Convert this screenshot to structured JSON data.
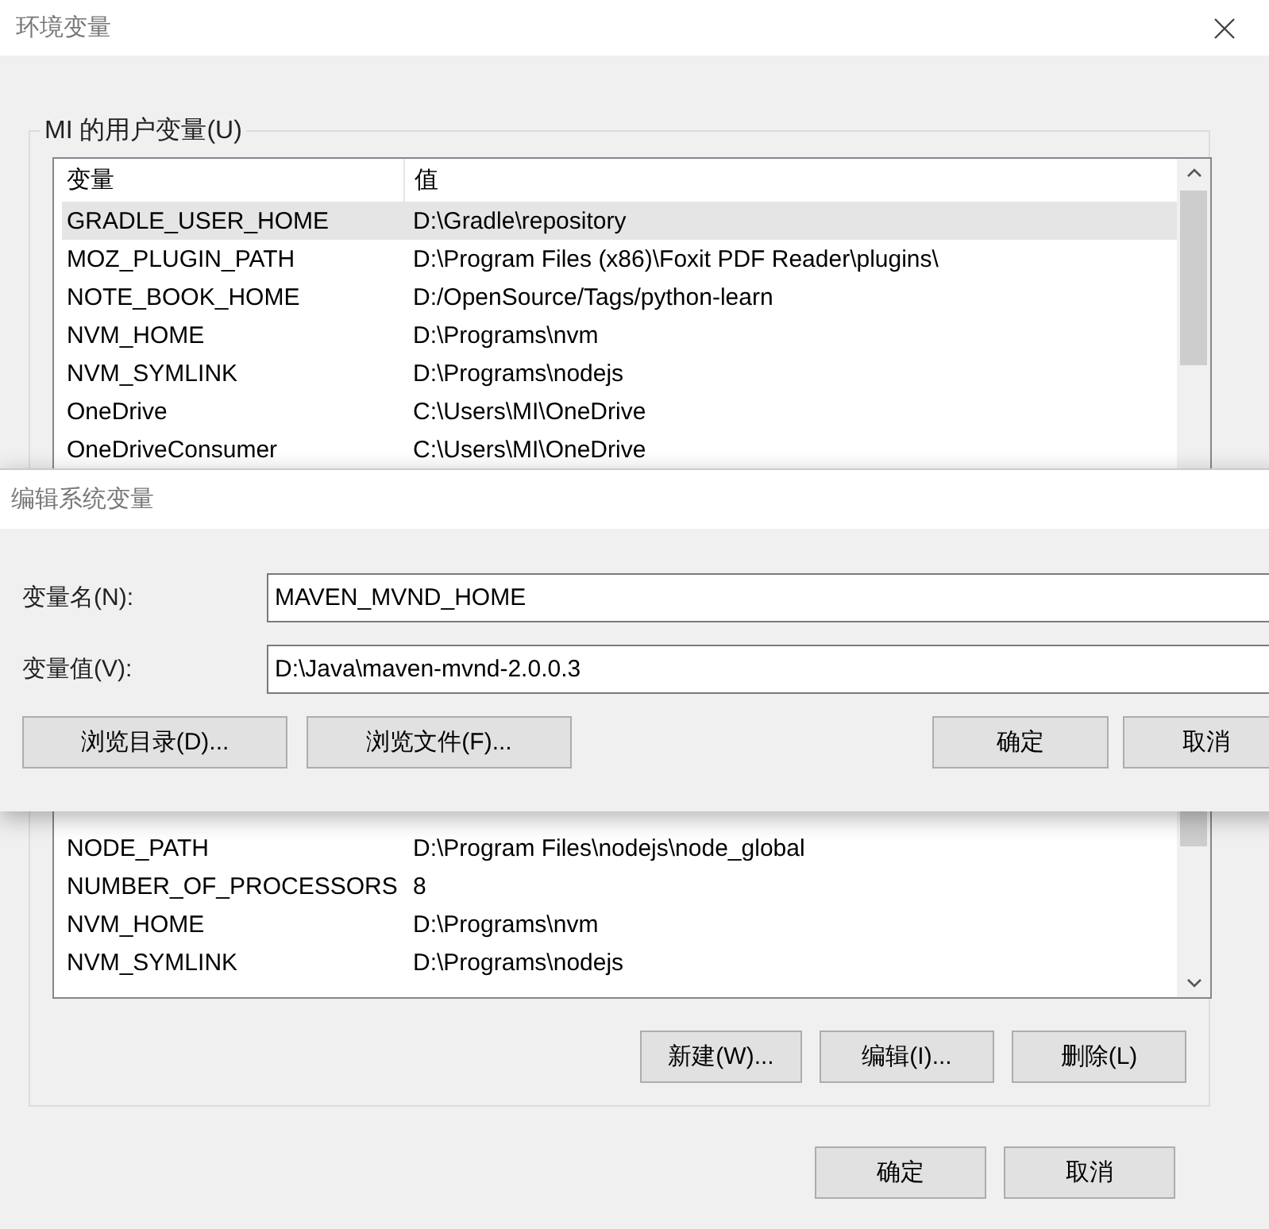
{
  "window": {
    "title": "环境变量"
  },
  "user_variables": {
    "title": "MI 的用户变量(U)",
    "columns": [
      "变量",
      "值"
    ],
    "rows": [
      {
        "name": "GRADLE_USER_HOME",
        "value": "D:\\Gradle\\repository",
        "selected": true
      },
      {
        "name": "MOZ_PLUGIN_PATH",
        "value": "D:\\Program Files (x86)\\Foxit PDF Reader\\plugins\\",
        "selected": false
      },
      {
        "name": "NOTE_BOOK_HOME",
        "value": "D:/OpenSource/Tags/python-learn",
        "selected": false
      },
      {
        "name": "NVM_HOME",
        "value": "D:\\Programs\\nvm",
        "selected": false
      },
      {
        "name": "NVM_SYMLINK",
        "value": "D:\\Programs\\nodejs",
        "selected": false
      },
      {
        "name": "OneDrive",
        "value": "C:\\Users\\MI\\OneDrive",
        "selected": false
      },
      {
        "name": "OneDriveConsumer",
        "value": "C:\\Users\\MI\\OneDrive",
        "selected": false
      }
    ]
  },
  "edit_dialog": {
    "title": "编辑系统变量",
    "fields": [
      {
        "label": "变量名(N):",
        "value": "MAVEN_MVND_HOME"
      },
      {
        "label": "变量值(V):",
        "value": "D:\\Java\\maven-mvnd-2.0.0.3"
      }
    ],
    "left_buttons": [
      "浏览目录(D)...",
      "浏览文件(F)..."
    ],
    "right_buttons": [
      "确定",
      "取消"
    ]
  },
  "system_variables": {
    "rows": [
      {
        "name": "NODE_PATH",
        "value": "D:\\Program Files\\nodejs\\node_global",
        "selected": false
      },
      {
        "name": "NUMBER_OF_PROCESSORS",
        "value": "8",
        "selected": false
      },
      {
        "name": "NVM_HOME",
        "value": "D:\\Programs\\nvm",
        "selected": false
      },
      {
        "name": "NVM_SYMLINK",
        "value": "D:\\Programs\\nodejs",
        "selected": false
      }
    ],
    "buttons": [
      "新建(W)...",
      "编辑(I)...",
      "删除(L)"
    ]
  },
  "footer_buttons": [
    "确定",
    "取消"
  ]
}
